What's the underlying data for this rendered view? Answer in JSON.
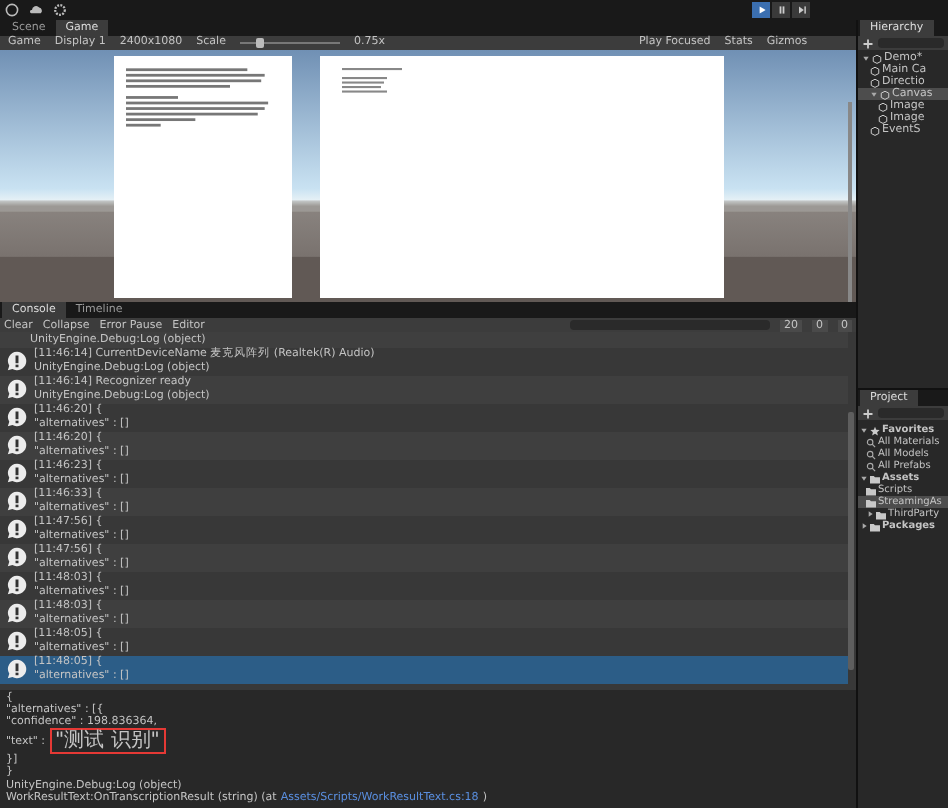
{
  "toolbar": {
    "playing": true
  },
  "scene_tabs": [
    {
      "label": "Scene",
      "selected": false
    },
    {
      "label": "Game",
      "selected": true
    }
  ],
  "game_toolbar": {
    "view": "Game",
    "display": "Display 1",
    "resolution": "2400x1080",
    "scale_label": "Scale",
    "scale": "0.75x",
    "level": 0.2,
    "play_mode": "Play Focused",
    "stats": "Stats",
    "gizmos": "Gizmos"
  },
  "hierarchy": {
    "title": "Hierarchy",
    "items": [
      {
        "label": "Demo*",
        "expanded": true,
        "selected": false,
        "children": [
          {
            "label": "Main Ca",
            "selected": false
          },
          {
            "label": "Directio",
            "selected": false
          },
          {
            "label": "Canvas",
            "expanded": true,
            "selected": true,
            "children": [
              {
                "label": "Image",
                "selected": false
              },
              {
                "label": "Image",
                "selected": false
              }
            ]
          },
          {
            "label": "EventS",
            "selected": false
          }
        ]
      }
    ]
  },
  "console": {
    "tabs": [
      {
        "label": "Console",
        "selected": true
      },
      {
        "label": "Timeline",
        "selected": false
      }
    ],
    "buttons": [
      "Clear",
      "Collapse",
      "Error Pause",
      "Editor"
    ],
    "counts": [
      "20",
      "0",
      "0"
    ],
    "entries": [
      {
        "kind": "cut",
        "selected": false,
        "lines": [
          "UnityEngine.Debug:Log (object)"
        ]
      },
      {
        "kind": "log",
        "selected": false,
        "lines": [
          "[11:46:14] CurrentDeviceName 麦克风阵列 (Realtek(R) Audio)",
          "UnityEngine.Debug:Log (object)"
        ]
      },
      {
        "kind": "log",
        "selected": false,
        "lines": [
          "[11:46:14] Recognizer ready",
          "UnityEngine.Debug:Log (object)"
        ]
      },
      {
        "kind": "log",
        "selected": false,
        "lines": [
          "[11:46:20] {",
          "\"alternatives\" : []"
        ]
      },
      {
        "kind": "log",
        "selected": false,
        "lines": [
          "[11:46:20] {",
          "\"alternatives\" : []"
        ]
      },
      {
        "kind": "log",
        "selected": false,
        "lines": [
          "[11:46:23] {",
          "\"alternatives\" : []"
        ]
      },
      {
        "kind": "log",
        "selected": false,
        "lines": [
          "[11:46:33] {",
          "\"alternatives\" : []"
        ]
      },
      {
        "kind": "log",
        "selected": false,
        "lines": [
          "[11:47:56] {",
          "\"alternatives\" : []"
        ]
      },
      {
        "kind": "log",
        "selected": false,
        "lines": [
          "[11:47:56] {",
          "\"alternatives\" : []"
        ]
      },
      {
        "kind": "log",
        "selected": false,
        "lines": [
          "[11:48:03] {",
          "\"alternatives\" : []"
        ]
      },
      {
        "kind": "log",
        "selected": false,
        "lines": [
          "[11:48:03] {",
          "\"alternatives\" : []"
        ]
      },
      {
        "kind": "log",
        "selected": false,
        "lines": [
          "[11:48:05] {",
          "\"alternatives\" : []"
        ]
      },
      {
        "kind": "log",
        "selected": true,
        "lines": [
          "[11:48:05] {",
          "\"alternatives\" : []"
        ]
      }
    ],
    "detail": [
      {
        "text": "{"
      },
      {
        "text": "\"alternatives\" : [{"
      },
      {
        "text": "\"confidence\" : 198.836364,"
      },
      {
        "text": "\"text\" :",
        "marked": "\"测试 识别\""
      },
      {
        "text": "}]"
      },
      {
        "text": "}"
      },
      {
        "text": "UnityEngine.Debug:Log (object)"
      },
      {
        "text": "WorkResultText:OnTranscriptionResult (string) (at ",
        "link": "Assets/Scripts/WorkResultText.cs:18",
        "after": ")"
      }
    ]
  },
  "project": {
    "title": "Project",
    "tree": [
      {
        "label": "Favorites",
        "kind": "favorites",
        "expanded": true,
        "selected": false,
        "children": [
          {
            "label": "All Materials",
            "kind": "search",
            "selected": false
          },
          {
            "label": "All Models",
            "kind": "search",
            "selected": false
          },
          {
            "label": "All Prefabs",
            "kind": "search",
            "selected": false
          }
        ]
      },
      {
        "label": "Assets",
        "kind": "folder",
        "expanded": true,
        "selected": false,
        "children": [
          {
            "label": "Scripts",
            "kind": "folder",
            "selected": false
          },
          {
            "label": "StreamingAs",
            "kind": "folder",
            "selected": true
          },
          {
            "label": "ThirdParty",
            "kind": "folder",
            "expanded": false,
            "selected": false
          }
        ]
      },
      {
        "label": "Packages",
        "kind": "folder",
        "expanded": false,
        "selected": false
      }
    ]
  }
}
